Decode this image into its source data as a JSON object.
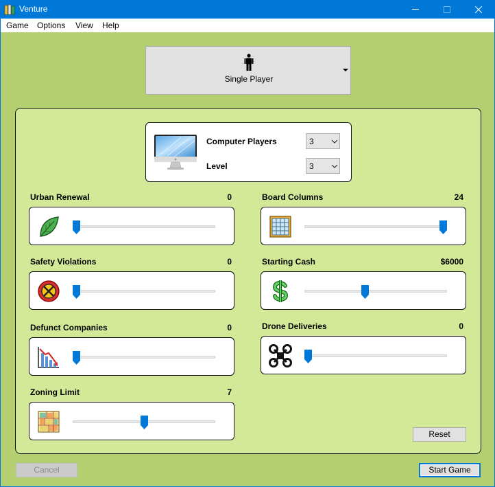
{
  "window": {
    "title": "Venture",
    "accent_color": "#0078d7",
    "background_color": "#b4cf70",
    "panel_color": "#d3e998"
  },
  "menu": {
    "items": [
      "Game",
      "Options",
      "View",
      "Help"
    ]
  },
  "mode_selector": {
    "label": "Single Player",
    "icon": "person-icon"
  },
  "computer": {
    "icon": "monitor-icon",
    "players_label": "Computer Players",
    "players_value": "3",
    "level_label": "Level",
    "level_value": "3"
  },
  "options": {
    "urban_renewal": {
      "label": "Urban Renewal",
      "value": "0",
      "icon": "leaf-icon",
      "fraction": 0.0
    },
    "board_columns": {
      "label": "Board Columns",
      "value": "24",
      "icon": "grid-icon",
      "fraction": 1.0
    },
    "safety_violations": {
      "label": "Safety Violations",
      "value": "0",
      "icon": "no-entry-icon",
      "fraction": 0.0
    },
    "starting_cash": {
      "label": "Starting Cash",
      "value": "$6000",
      "icon": "dollar-icon",
      "fraction": 0.42
    },
    "defunct_companies": {
      "label": "Defunct Companies",
      "value": "0",
      "icon": "declining-chart-icon",
      "fraction": 0.0
    },
    "drone_deliveries": {
      "label": "Drone Deliveries",
      "value": "0",
      "icon": "drone-icon",
      "fraction": 0.0
    },
    "zoning_limit": {
      "label": "Zoning Limit",
      "value": "7",
      "icon": "zoning-map-icon",
      "fraction": 0.5
    }
  },
  "buttons": {
    "reset": "Reset",
    "cancel": "Cancel",
    "start": "Start Game"
  }
}
